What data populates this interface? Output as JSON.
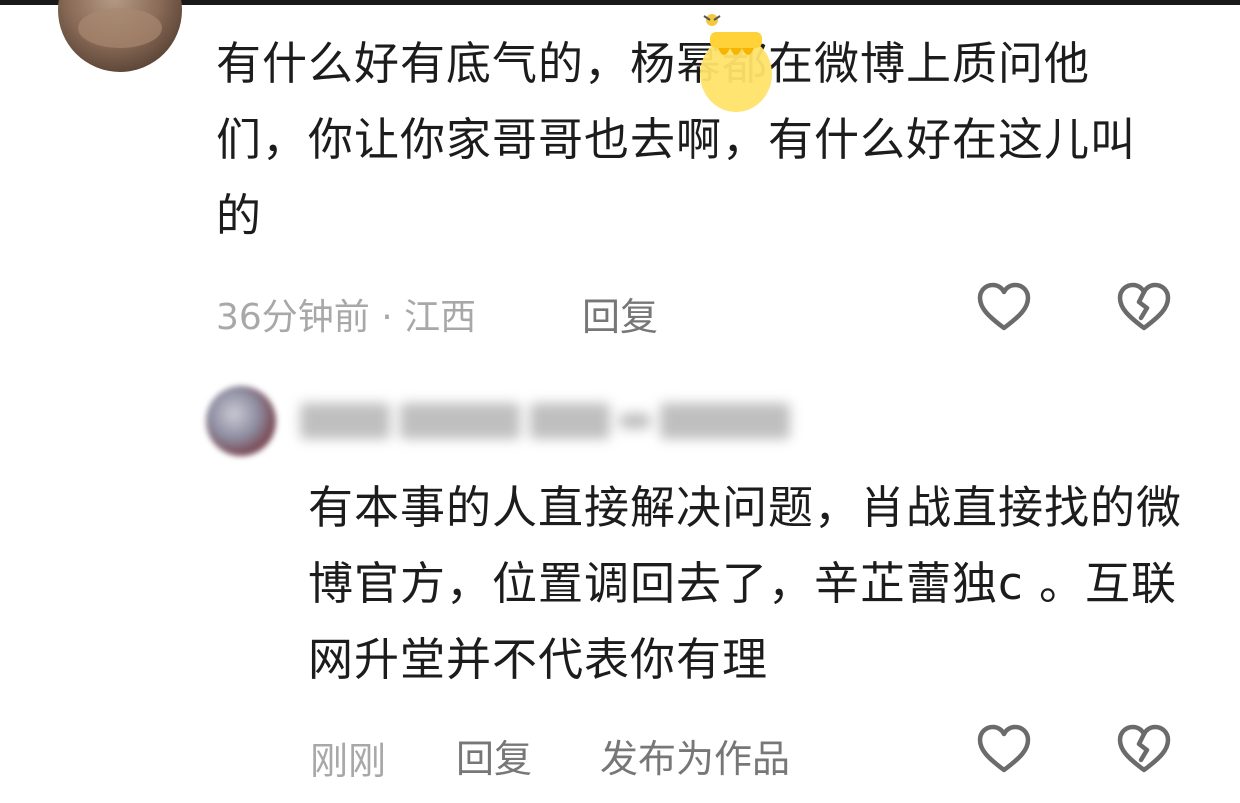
{
  "comments": [
    {
      "text": "有什么好有底气的，杨幂都在微博上质问他们，你让你家哥哥也去啊，有什么好在这儿叫的",
      "meta": "36分钟前 · 江西",
      "reply_label": "回复",
      "like_icon": "heart-outline-icon",
      "dislike_icon": "broken-heart-icon"
    },
    {
      "text": "有本事的人直接解决问题，肖战直接找的微博官方，位置调回去了，辛芷蕾独c 。互联网升堂并不代表你有理",
      "meta": "刚刚",
      "reply_label": "回复",
      "publish_label": "发布为作品",
      "like_icon": "heart-outline-icon",
      "dislike_icon": "broken-heart-icon"
    }
  ]
}
